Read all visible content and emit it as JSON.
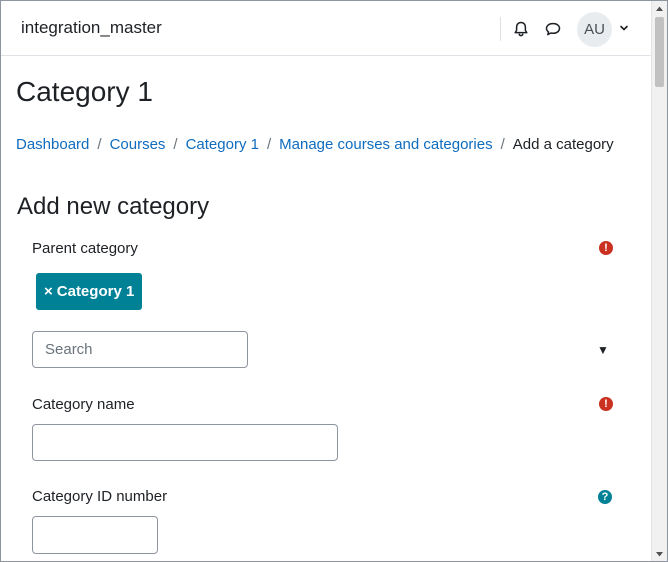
{
  "navbar": {
    "site_name": "integration_master",
    "avatar_initials": "AU",
    "icons": [
      "bell-icon",
      "chat-icon",
      "chevron-down-icon"
    ]
  },
  "page": {
    "title": "Category 1"
  },
  "breadcrumb": {
    "items": [
      "Dashboard",
      "Courses",
      "Category 1",
      "Manage courses and categories"
    ],
    "current": "Add a category",
    "separator": "/"
  },
  "form": {
    "heading": "Add new category",
    "parent_category": {
      "label": "Parent category",
      "selected_tag": "Category 1",
      "remove_symbol": "×",
      "search_placeholder": "Search"
    },
    "category_name": {
      "label": "Category name",
      "value": ""
    },
    "category_id_number": {
      "label": "Category ID number",
      "value": ""
    }
  },
  "colors": {
    "link": "#0f6cbf",
    "required": "#ca3120",
    "accent": "#008196",
    "text": "#1d2125"
  }
}
